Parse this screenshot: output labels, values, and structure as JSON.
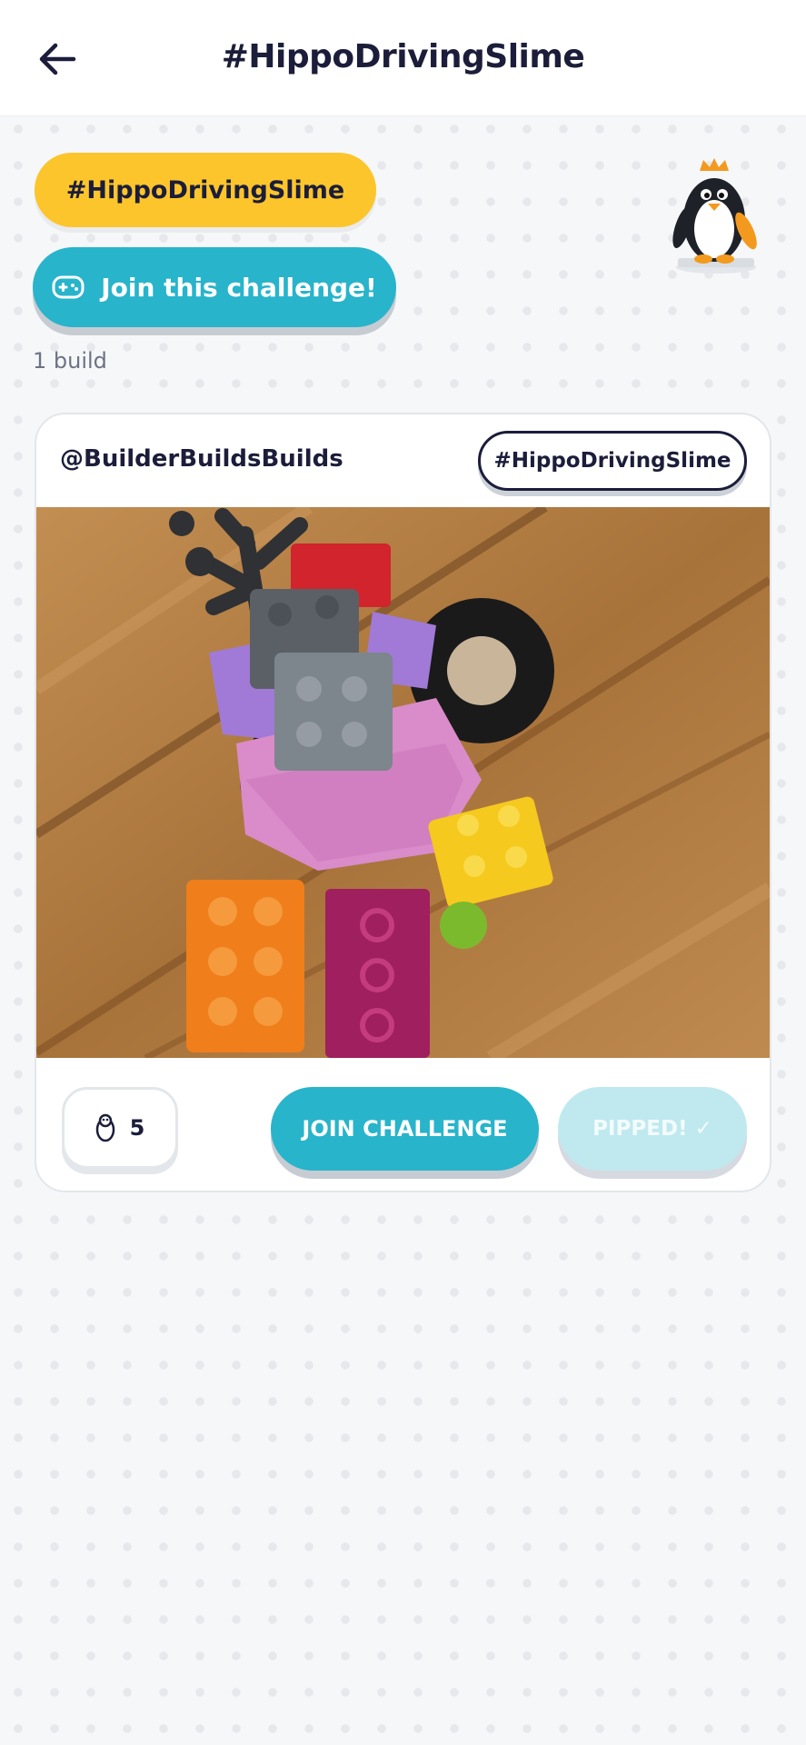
{
  "header": {
    "title": "#HippoDrivingSlime",
    "back_icon": "arrow-left-icon"
  },
  "challenge": {
    "tag": "#HippoDrivingSlime",
    "join_label": "Join this challenge!",
    "join_icon": "gamepad-icon",
    "build_count": "1 build",
    "mascot": "penguin-king-mascot"
  },
  "post": {
    "username": "@BuilderBuildsBuilds",
    "tag": "#HippoDrivingSlime",
    "photo": "lego-build-photo",
    "likes": "5",
    "like_icon": "penguin-icon",
    "join_label": "JOIN CHALLENGE",
    "pipped_label": "PIPPED!",
    "pipped_icon": "checkmark-icon"
  },
  "colors": {
    "accent_teal": "#28b4cb",
    "tag_yellow": "#fcc52b",
    "pipped_disabled": "#bfe9ef",
    "text_dark": "#1b1d3a",
    "background": "#f6f7f9"
  }
}
